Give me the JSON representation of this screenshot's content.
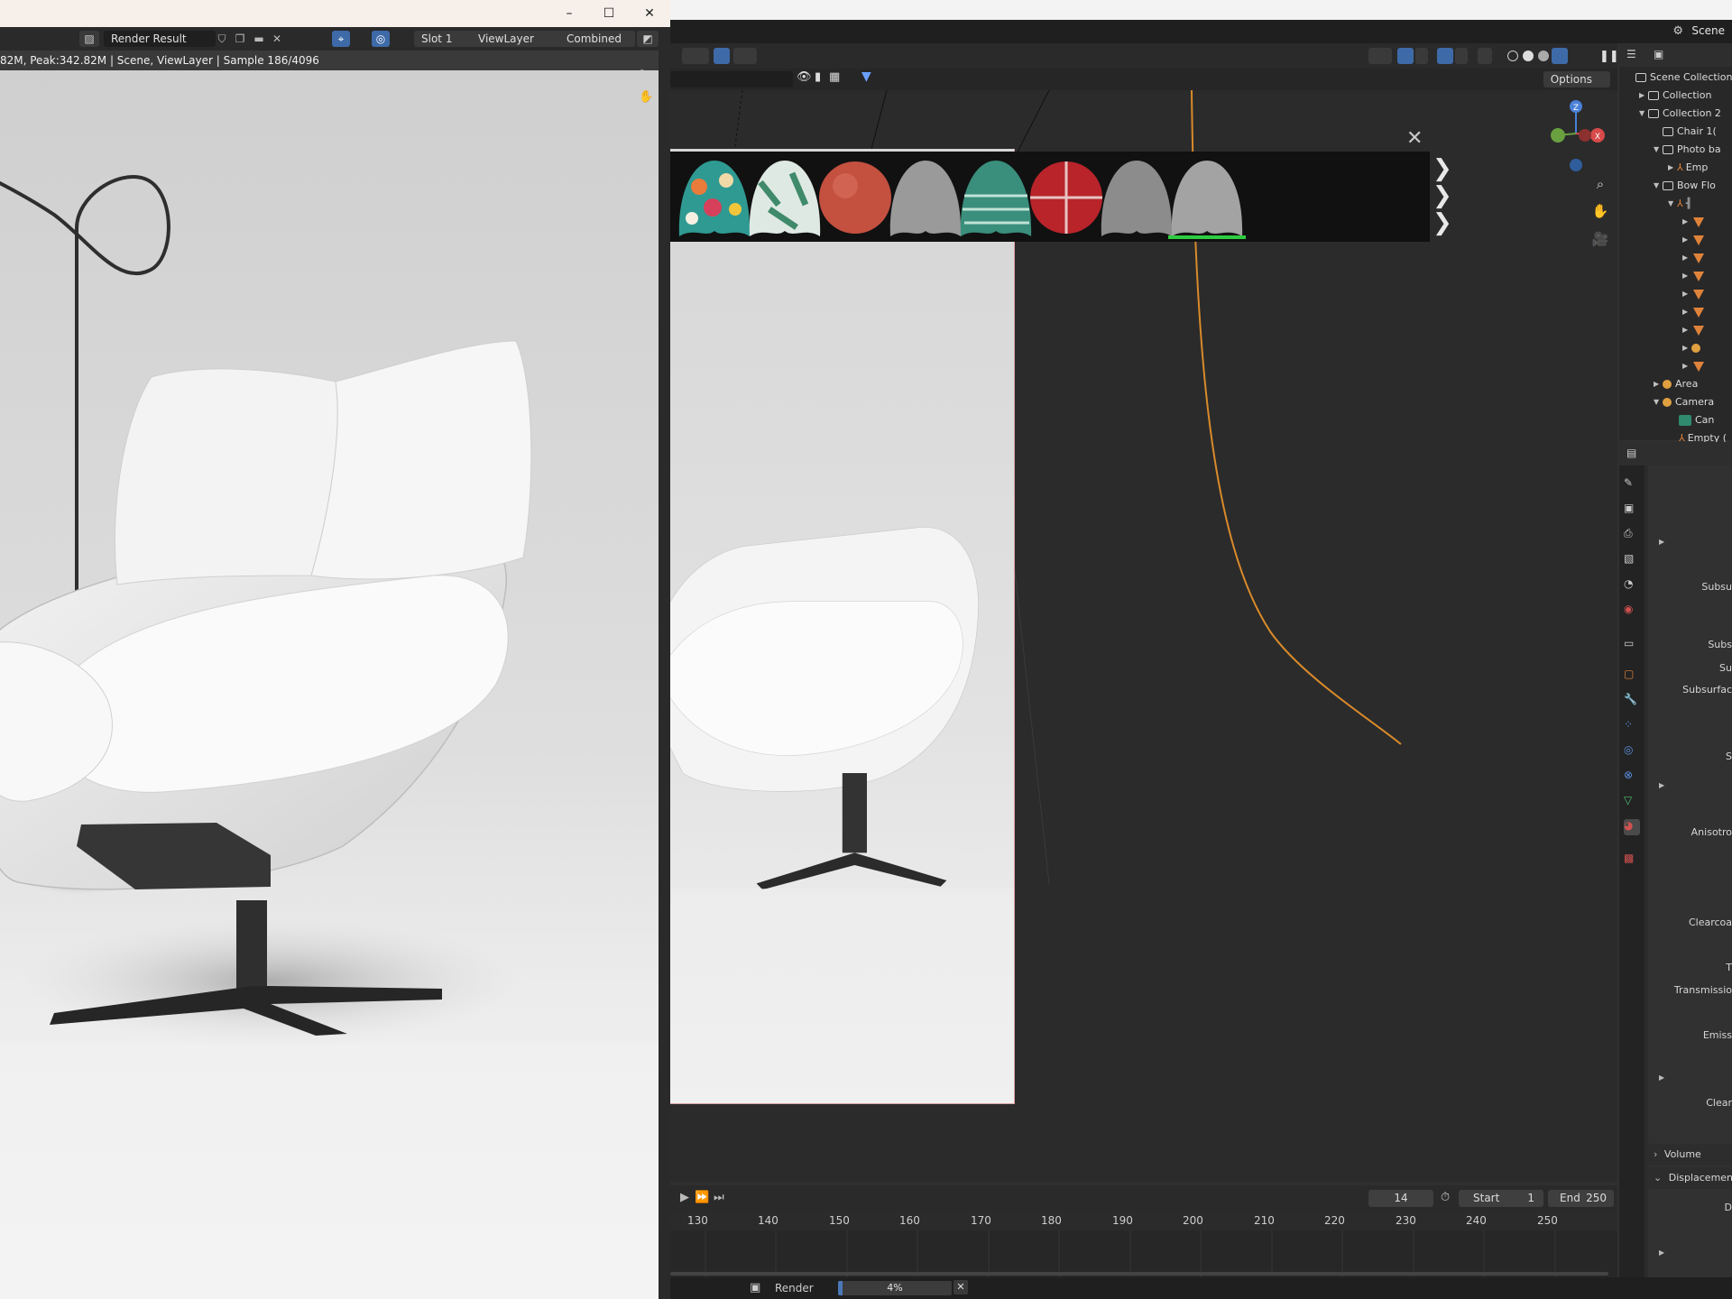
{
  "render_window": {
    "title_buttons": {
      "minimize": "–",
      "maximize": "☐",
      "close": "✕"
    },
    "image_name": "Render Result",
    "slot": "Slot 1",
    "view_layer": "ViewLayer",
    "pass": "Combined",
    "info_text": "82M, Peak:342.82M | Scene, ViewLayer | Sample 186/4096"
  },
  "main_window": {
    "scene_label": "Scene",
    "viewport_options": "Options",
    "material_close": "✕",
    "gizmo_axes": {
      "z": "Z",
      "x": "X"
    },
    "timeline": {
      "current_frame": "14",
      "start_label": "Start",
      "start_value": "1",
      "end_label": "End",
      "end_value": "250",
      "ruler": [
        "130",
        "140",
        "150",
        "160",
        "170",
        "180",
        "190",
        "200",
        "210",
        "220",
        "230",
        "240",
        "250"
      ]
    },
    "status": {
      "render_label": "Render",
      "progress_text": "4%",
      "progress_value": 0.04
    }
  },
  "outliner": {
    "rows": [
      {
        "label": "Scene Collection",
        "type": "collection"
      },
      {
        "label": "Collection",
        "type": "collection"
      },
      {
        "label": "Collection 2",
        "type": "collection"
      },
      {
        "label": "Chair 1(",
        "type": "collection"
      },
      {
        "label": "Photo ba",
        "type": "collection"
      },
      {
        "label": "Emp",
        "type": "empty"
      },
      {
        "label": "Bow Flo",
        "type": "collection"
      },
      {
        "label": "Area",
        "type": "light"
      },
      {
        "label": "Camera",
        "type": "camera"
      },
      {
        "label": "Can",
        "type": "camera-data"
      },
      {
        "label": "Empty (",
        "type": "empty"
      }
    ]
  },
  "properties": {
    "labels": [
      "Subsu",
      "Subs",
      "Su",
      "Subsurfac",
      "S",
      "Anisotro",
      "Clearcoa",
      "T",
      "Transmissio",
      "Emiss",
      "Clear"
    ],
    "sections": {
      "volume": "Volume",
      "displacement": "Displacemen",
      "d": "D"
    }
  },
  "colors": {
    "accent_blue": "#4a77b8",
    "object_orange": "#e0833a",
    "fcurve_orange": "#d98a2a",
    "camera_frame": "#d7a0a0"
  }
}
